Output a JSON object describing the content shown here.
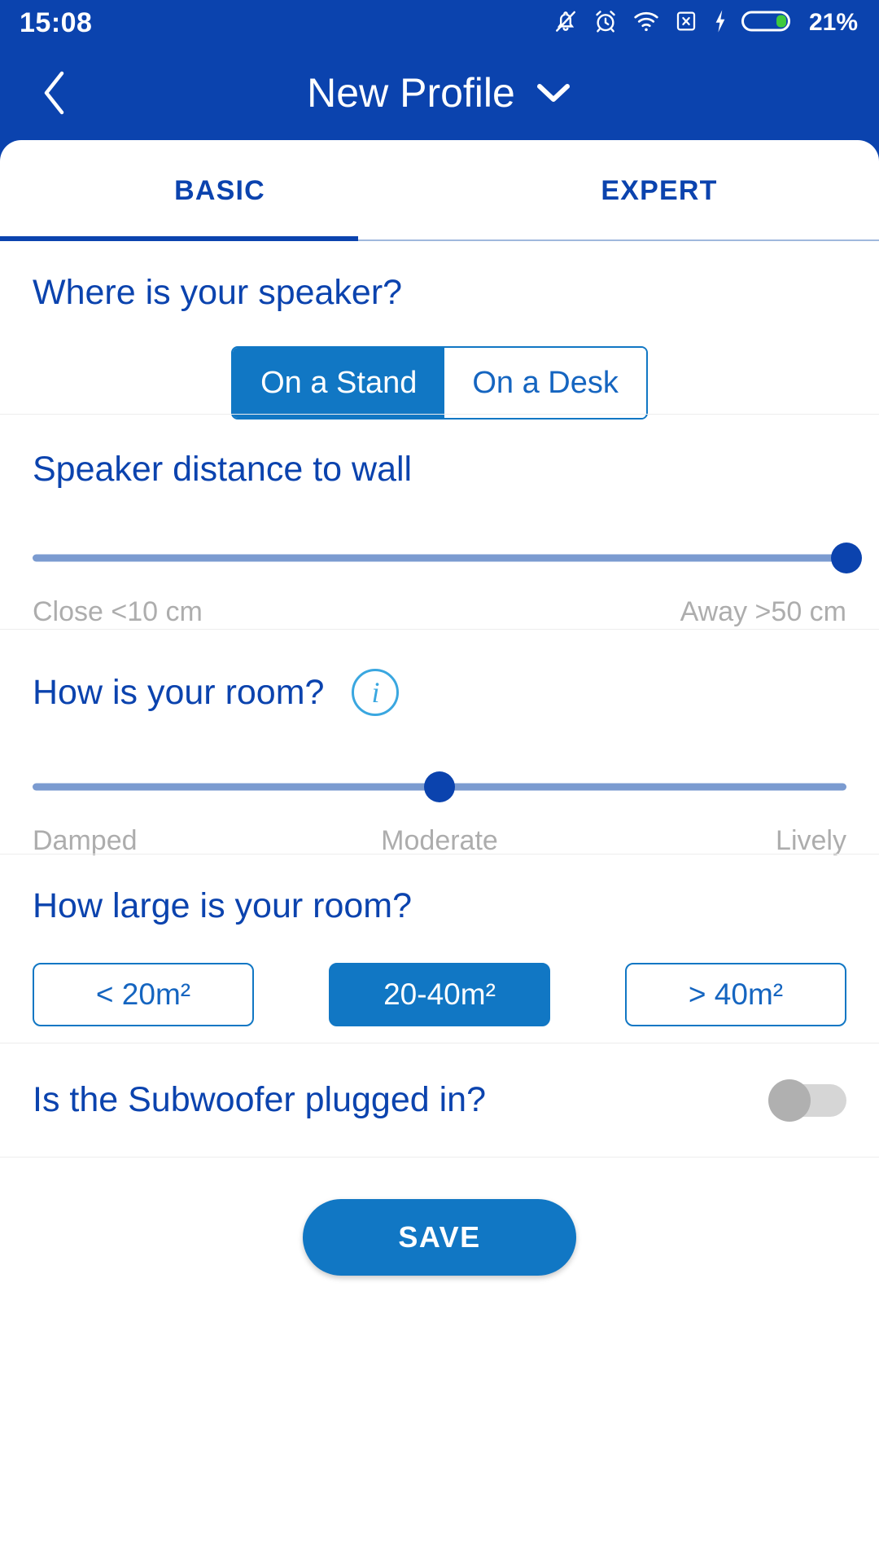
{
  "status_bar": {
    "time": "15:08",
    "battery_percent": "21%",
    "icons": [
      "bell-muted-icon",
      "alarm-clock-icon",
      "wifi-icon",
      "sim-card-missing-icon",
      "charging-bolt-icon",
      "battery-icon"
    ]
  },
  "app_bar": {
    "back_label": "back-chevron",
    "title": "New Profile",
    "dropdown_label": "chevron-down"
  },
  "tabs": {
    "items": [
      {
        "label": "BASIC",
        "active": true
      },
      {
        "label": "EXPERT",
        "active": false
      }
    ]
  },
  "sections": {
    "speaker_position": {
      "title": "Where is your speaker?",
      "options": [
        {
          "label": "On a Stand",
          "selected": true
        },
        {
          "label": "On a Desk",
          "selected": false
        }
      ]
    },
    "distance": {
      "title": "Speaker distance to wall",
      "value_percent": 100,
      "min_label": "Close <10 cm",
      "max_label": "Away >50 cm"
    },
    "room_character": {
      "title": "How is your room?",
      "info_glyph": "i",
      "value_percent": 50,
      "labels": [
        "Damped",
        "Moderate",
        "Lively"
      ]
    },
    "room_size": {
      "title": "How large is your room?",
      "options": [
        {
          "label": "< 20m²",
          "selected": false
        },
        {
          "label": "20-40m²",
          "selected": true
        },
        {
          "label": "> 40m²",
          "selected": false
        }
      ]
    },
    "subwoofer": {
      "title": "Is the Subwoofer plugged in?",
      "enabled": false
    }
  },
  "footer": {
    "save_label": "SAVE"
  },
  "colors": {
    "header_blue": "#0B43AE",
    "accent_blue": "#1177c4",
    "text_blue": "#0B43AE",
    "muted_gray": "#adadad",
    "track_blue": "#7b9bd0",
    "info_blue": "#3aa7e0",
    "battery_green": "#3ec93e"
  }
}
